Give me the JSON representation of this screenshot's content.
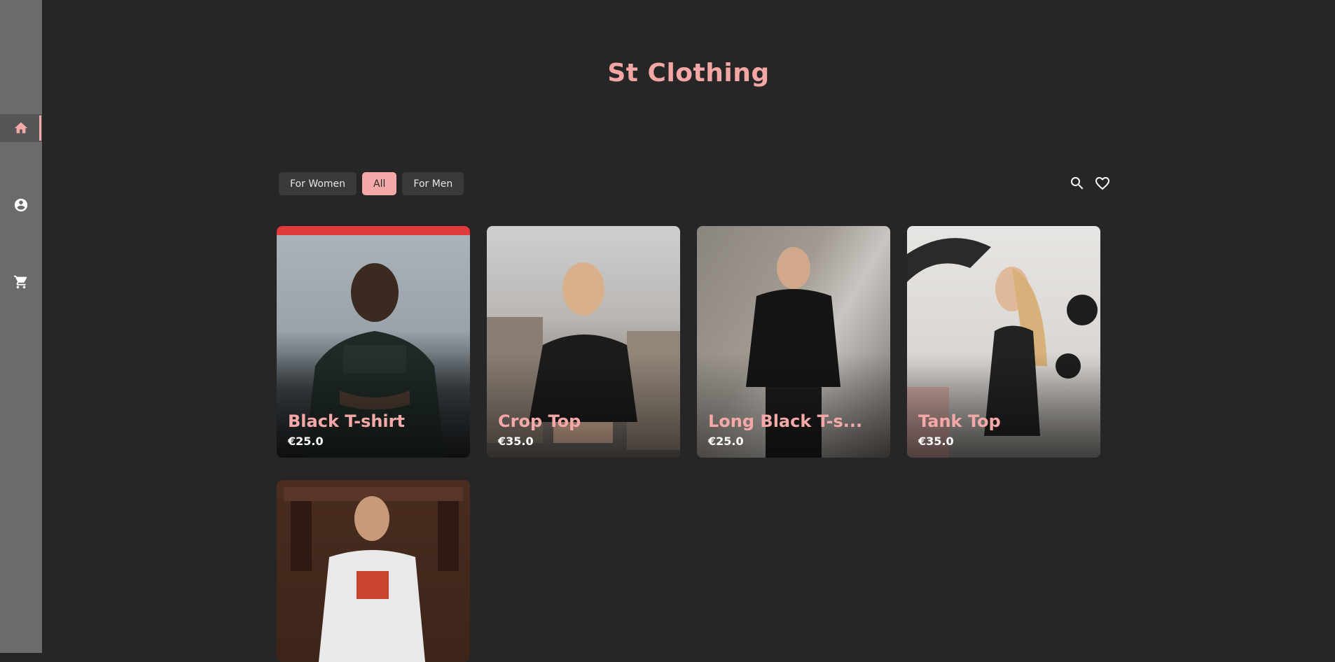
{
  "app": {
    "title": "St Clothing"
  },
  "sidebar": {
    "items": [
      {
        "icon": "home-icon",
        "active": true
      },
      {
        "icon": "account-circle-icon",
        "active": false
      },
      {
        "icon": "shopping-cart-icon",
        "active": false
      }
    ]
  },
  "filters": [
    {
      "label": "For Women",
      "active": false
    },
    {
      "label": "All",
      "active": true
    },
    {
      "label": "For Men",
      "active": false
    }
  ],
  "toolbar": {
    "icons": [
      "search-icon",
      "heart-outline-icon"
    ]
  },
  "products": [
    {
      "name": "Black T-shirt",
      "price": "€25.0"
    },
    {
      "name": "Crop Top",
      "price": "€35.0"
    },
    {
      "name": "Long Black T-s...",
      "price": "€25.0"
    },
    {
      "name": "Tank Top",
      "price": "€35.0"
    },
    {
      "name": "",
      "price": ""
    }
  ],
  "colors": {
    "accent": "#f4a9a8",
    "background": "#262626",
    "sidebar": "#6b6b6b",
    "chip": "#3a3a3a"
  }
}
